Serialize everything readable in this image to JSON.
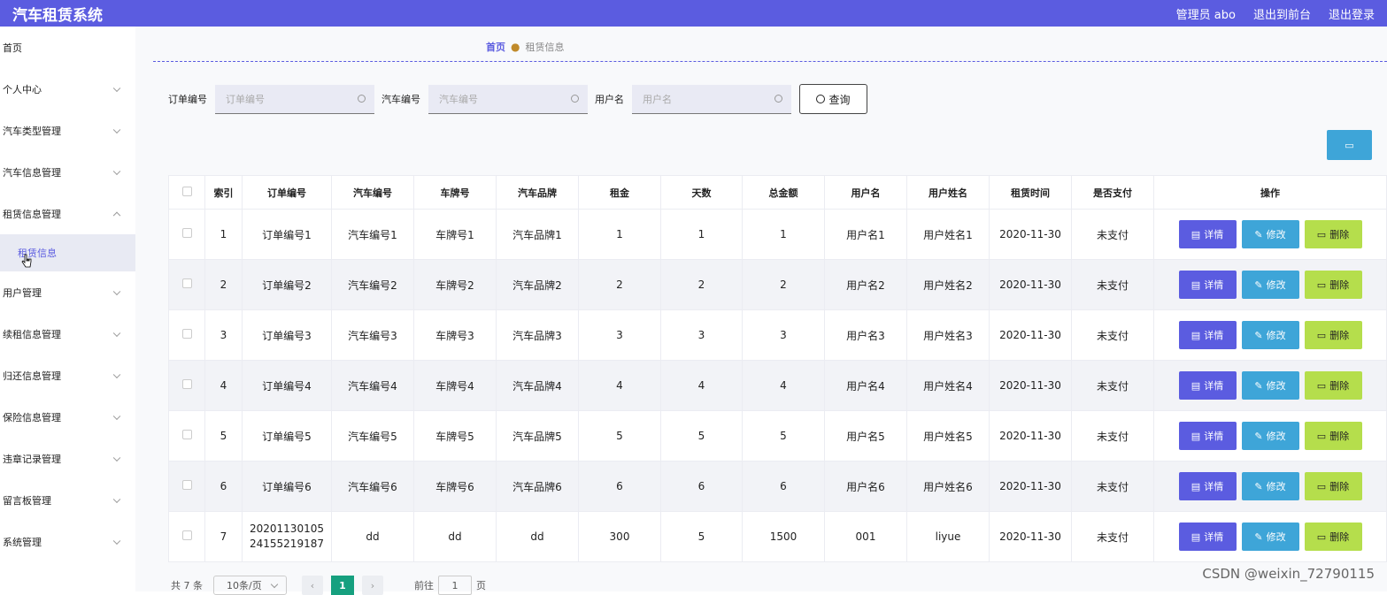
{
  "app": {
    "title": "汽车租赁系统",
    "admin": "管理员 abo",
    "back_front": "退出到前台",
    "logout": "退出登录"
  },
  "sidebar": {
    "items": [
      {
        "label": "首页"
      },
      {
        "label": "个人中心"
      },
      {
        "label": "汽车类型管理"
      },
      {
        "label": "汽车信息管理"
      },
      {
        "label": "租赁信息管理"
      },
      {
        "label": "用户管理"
      },
      {
        "label": "续租信息管理"
      },
      {
        "label": "归还信息管理"
      },
      {
        "label": "保险信息管理"
      },
      {
        "label": "违章记录管理"
      },
      {
        "label": "留言板管理"
      },
      {
        "label": "系统管理"
      }
    ],
    "active_sub": "租赁信息"
  },
  "breadcrumb": {
    "home": "首页",
    "current": "租赁信息"
  },
  "filters": {
    "order_label": "订单编号",
    "order_ph": "订单编号",
    "car_label": "汽车编号",
    "car_ph": "汽车编号",
    "user_label": "用户名",
    "user_ph": "用户名",
    "search": "查询"
  },
  "table": {
    "headers": [
      "索引",
      "订单编号",
      "汽车编号",
      "车牌号",
      "汽车品牌",
      "租金",
      "天数",
      "总金额",
      "用户名",
      "用户姓名",
      "租赁时间",
      "是否支付",
      "操作"
    ],
    "rows": [
      [
        "1",
        "订单编号1",
        "汽车编号1",
        "车牌号1",
        "汽车品牌1",
        "1",
        "1",
        "1",
        "用户名1",
        "用户姓名1",
        "2020-11-30",
        "未支付"
      ],
      [
        "2",
        "订单编号2",
        "汽车编号2",
        "车牌号2",
        "汽车品牌2",
        "2",
        "2",
        "2",
        "用户名2",
        "用户姓名2",
        "2020-11-30",
        "未支付"
      ],
      [
        "3",
        "订单编号3",
        "汽车编号3",
        "车牌号3",
        "汽车品牌3",
        "3",
        "3",
        "3",
        "用户名3",
        "用户姓名3",
        "2020-11-30",
        "未支付"
      ],
      [
        "4",
        "订单编号4",
        "汽车编号4",
        "车牌号4",
        "汽车品牌4",
        "4",
        "4",
        "4",
        "用户名4",
        "用户姓名4",
        "2020-11-30",
        "未支付"
      ],
      [
        "5",
        "订单编号5",
        "汽车编号5",
        "车牌号5",
        "汽车品牌5",
        "5",
        "5",
        "5",
        "用户名5",
        "用户姓名5",
        "2020-11-30",
        "未支付"
      ],
      [
        "6",
        "订单编号6",
        "汽车编号6",
        "车牌号6",
        "汽车品牌6",
        "6",
        "6",
        "6",
        "用户名6",
        "用户姓名6",
        "2020-11-30",
        "未支付"
      ],
      [
        "7",
        "2020113010524155219187",
        "dd",
        "dd",
        "dd",
        "300",
        "5",
        "1500",
        "001",
        "liyue",
        "2020-11-30",
        "未支付"
      ]
    ],
    "actions": {
      "detail": "详情",
      "edit": "修改",
      "delete": "删除"
    }
  },
  "pager": {
    "total": "共 7 条",
    "size": "10条/页",
    "page": "1",
    "goto": "前往",
    "goto_value": "1",
    "unit": "页"
  },
  "watermark": "CSDN @weixin_72790115",
  "colors": {
    "primary": "#5b5ce0",
    "edit": "#3ea5d8",
    "delete": "#b5de4c",
    "pager_active": "#16a07f"
  }
}
